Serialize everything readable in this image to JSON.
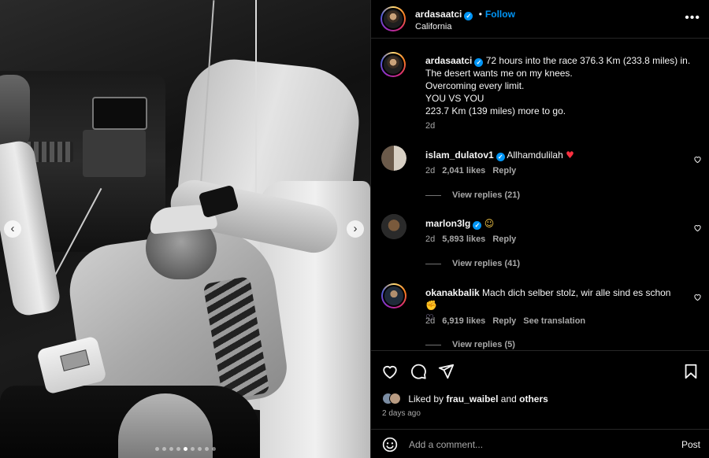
{
  "post": {
    "author": "ardasaatci",
    "follow_label": "Follow",
    "location": "California",
    "more_icon": "more-horizontal-icon"
  },
  "caption": {
    "username": "ardasaatci",
    "lines": [
      "72 hours into the race 376.3 Km (233.8 miles) in.",
      "The desert wants me on my knees.",
      "Overcoming every limit.",
      "YOU VS YOU",
      "223.7 Km (139 miles) more to go."
    ],
    "time": "2d"
  },
  "comments": [
    {
      "username": "islam_dulatov1",
      "verified": true,
      "text": "Allhamdulilah",
      "emoji": "♥",
      "time": "2d",
      "likes": "2,041 likes",
      "reply_label": "Reply",
      "replies": "View replies (21)"
    },
    {
      "username": "marlon3lg",
      "verified": true,
      "text": "",
      "emoji": "☺",
      "time": "2d",
      "likes": "5,893 likes",
      "reply_label": "Reply",
      "replies": "View replies (41)"
    },
    {
      "username": "okanakbalik",
      "verified": false,
      "text": "Mach dich selber stolz, wir alle sind es schon",
      "emoji": "✊",
      "emoji2": "♡",
      "time": "2d",
      "likes": "6,919 likes",
      "reply_label": "Reply",
      "translate_label": "See translation",
      "replies": "View replies (5)"
    }
  ],
  "likes": {
    "prefix": "Liked by",
    "user": "frau_waibel",
    "connector": "and",
    "others": "others",
    "ago": "2 days ago"
  },
  "add_comment": {
    "placeholder": "Add a comment...",
    "post_label": "Post"
  },
  "carousel": {
    "prev_glyph": "‹",
    "next_glyph": "›",
    "dots": 9,
    "active_dot": 4
  },
  "colors": {
    "background": "#000000",
    "text": "#f5f5f5",
    "muted": "#a8a8a8",
    "link": "#0095f6",
    "like_heart": "#ff3040"
  }
}
